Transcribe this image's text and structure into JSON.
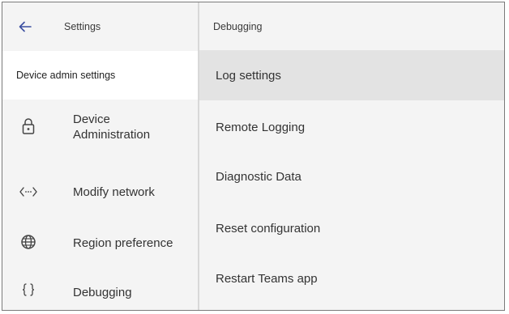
{
  "left_panel": {
    "back_icon": "arrow-left-icon",
    "title": "Settings",
    "section_header": "Device admin settings",
    "items": [
      {
        "label": "Device\nAdministration",
        "icon": "lock-icon"
      },
      {
        "label": "Modify network",
        "icon": "network-dots-icon"
      },
      {
        "label": "Region preference",
        "icon": "globe-icon"
      },
      {
        "label": "Debugging",
        "icon": "braces-icon"
      }
    ]
  },
  "right_panel": {
    "title": "Debugging",
    "items": [
      {
        "label": "Log settings",
        "selected": true
      },
      {
        "label": "Remote Logging"
      },
      {
        "label": "Diagnostic Data"
      },
      {
        "label": "Reset configuration"
      },
      {
        "label": "Restart Teams app"
      }
    ]
  },
  "colors": {
    "panel_bg": "#f4f4f4",
    "selected_bg": "#e3e3e3",
    "section_bg": "#ffffff",
    "divider": "#d8d8d8",
    "back_icon": "#3b4fa0"
  }
}
